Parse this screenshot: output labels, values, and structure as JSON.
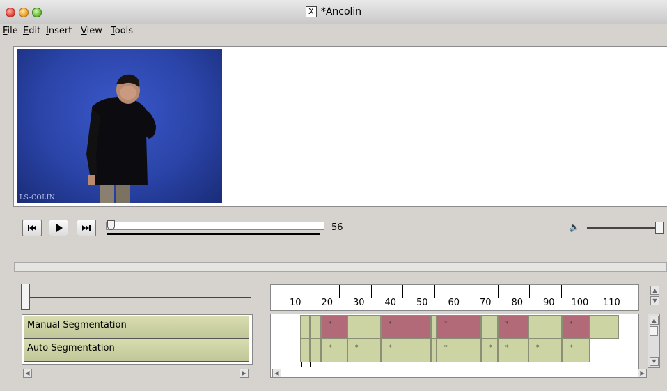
{
  "window": {
    "title": "*Ancolin"
  },
  "menu": [
    {
      "label": "File",
      "accel": "F",
      "rest": "ile"
    },
    {
      "label": "Edit",
      "accel": "E",
      "rest": "dit"
    },
    {
      "label": "Insert",
      "accel": "I",
      "rest": "nsert"
    },
    {
      "label": "View",
      "accel": "V",
      "rest": "iew"
    },
    {
      "label": "Tools",
      "accel": "T",
      "rest": "ools"
    }
  ],
  "video": {
    "watermark": "LS-COLIN"
  },
  "playback": {
    "frame": "56",
    "progress": 0.0,
    "volume": 1.0
  },
  "ruler": {
    "ticks": [
      "10",
      "20",
      "30",
      "40",
      "50",
      "60",
      "70",
      "80",
      "90",
      "100",
      "110"
    ]
  },
  "tracks": [
    {
      "label": "Manual Segmentation"
    },
    {
      "label": "Auto Segmentation"
    }
  ],
  "segments": {
    "manual": [
      {
        "type": "plain",
        "star": ""
      },
      {
        "type": "plain",
        "star": ""
      },
      {
        "type": "red",
        "star": "*"
      },
      {
        "type": "plain",
        "star": ""
      },
      {
        "type": "red",
        "star": "*"
      },
      {
        "type": "plain",
        "star": ""
      },
      {
        "type": "red",
        "star": "*"
      },
      {
        "type": "plain",
        "star": ""
      },
      {
        "type": "red",
        "star": "*"
      },
      {
        "type": "plain",
        "star": ""
      },
      {
        "type": "red",
        "star": "*"
      },
      {
        "type": "plain",
        "star": ""
      }
    ],
    "auto": [
      {
        "type": "plain",
        "star": ""
      },
      {
        "type": "plain",
        "star": ""
      },
      {
        "type": "plain",
        "star": "*"
      },
      {
        "type": "plain",
        "star": "*"
      },
      {
        "type": "plain",
        "star": "*"
      },
      {
        "type": "plain",
        "star": "**"
      },
      {
        "type": "plain",
        "star": "*"
      },
      {
        "type": "plain",
        "star": "*"
      },
      {
        "type": "plain",
        "star": "*"
      },
      {
        "type": "plain",
        "star": "*"
      },
      {
        "type": "plain",
        "star": "*"
      }
    ]
  },
  "colors": {
    "red_segment": "#b36a78",
    "plain_segment": "#cdd4a4",
    "video_bg": "#2a44a8"
  }
}
